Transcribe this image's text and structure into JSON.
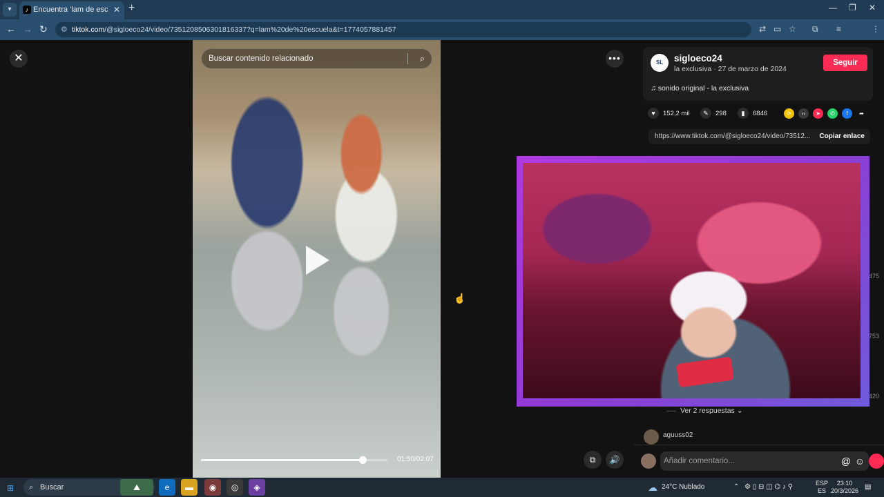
{
  "browser": {
    "tab_title": "Encuentra 'lam de escuela' en T",
    "tab_close": "✕",
    "new_tab": "+",
    "url_host": "tiktok.com",
    "url_path": "/@sigloeco24/video/7351208506301816337?q=lam%20de%20escuela&t=1774057881457",
    "window_controls": [
      "—",
      "❐",
      "✕"
    ]
  },
  "video": {
    "close_icon": "✕",
    "search_placeholder": "Buscar contenido relacionado",
    "time": "01:50/02:07",
    "progress": 0.866
  },
  "author": {
    "avatar_text": "SL",
    "name": "sigloeco24",
    "subtitle": "la exclusiva · 27 de marzo de 2024",
    "follow_label": "Seguir",
    "sound": "♫  sonido original - la exclusiva"
  },
  "stats": {
    "likes": "152,2 mil",
    "comments": "298",
    "saves": "6846"
  },
  "share": {
    "link": "https://www.tiktok.com/@sigloeco24/video/73512...",
    "copy_label": "Copiar enlace"
  },
  "side_numbers": [
    "475",
    "753",
    "420"
  ],
  "comments": {
    "replies_label": "Ver 2 respuestas ⌄",
    "comment_user": "aguuss02",
    "input_placeholder": "Añadir comentario..."
  },
  "taskbar": {
    "search_label": "Buscar",
    "weather": "24°C  Nublado",
    "lang_top": "ESP",
    "lang_bottom": "ES",
    "time": "23:10",
    "date": "20/3/2026"
  },
  "colors": {
    "accent": "#fe2c55",
    "chrome": "#2a4e6e",
    "cam_frame": "#b03be0"
  }
}
